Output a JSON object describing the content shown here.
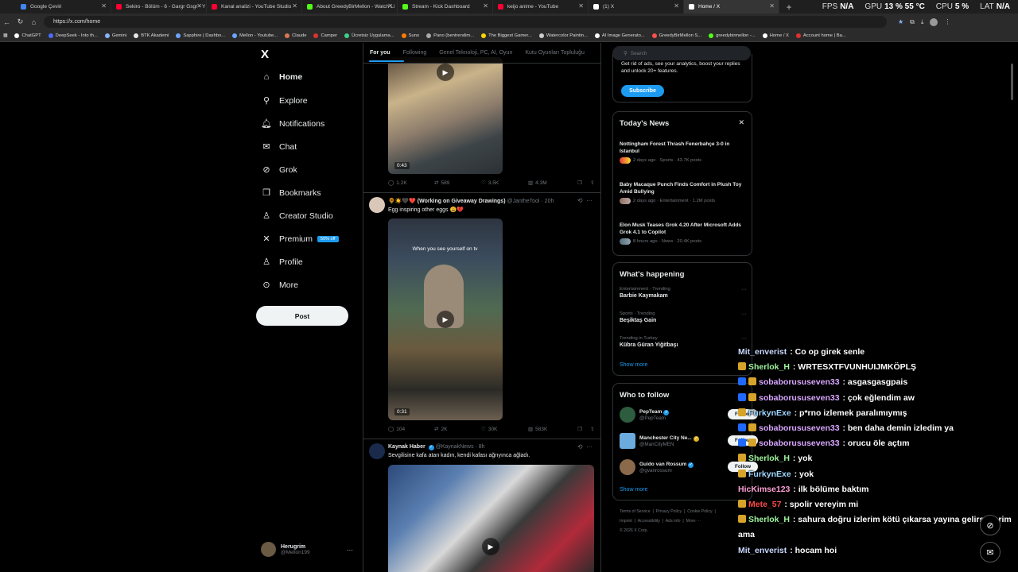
{
  "browser": {
    "tabs": [
      {
        "label": "Google Çeviri",
        "color": "#4285f4"
      },
      {
        "label": "Sekiro - Bölüm - 6 - Gargr Gsgr - Y",
        "color": "#ff0033"
      },
      {
        "label": "Kanal analizi - YouTube Studio",
        "color": "#ff0033"
      },
      {
        "label": "About GreedyBirMellon - Watch Li",
        "color": "#53fc18"
      },
      {
        "label": "Stream - Kick Dashboard",
        "color": "#53fc18"
      },
      {
        "label": "keijo anime - YouTube",
        "color": "#ff0033"
      },
      {
        "label": "(1) X",
        "color": "#ffffff"
      },
      {
        "label": "Home / X",
        "color": "#ffffff"
      }
    ],
    "url": "https://x.com/home",
    "hud": {
      "fps_label": "FPS",
      "fps_value": "N/A",
      "gpu_label": "GPU",
      "gpu_value": "13 % 55 °C",
      "cpu_label": "CPU",
      "cpu_value": "5 %",
      "lat_label": "LAT",
      "lat_value": "N/A"
    },
    "bookmarks": [
      {
        "label": "ChatGPT",
        "color": "#ffffff"
      },
      {
        "label": "DeepSeek - Into th...",
        "color": "#4d6bfe"
      },
      {
        "label": "Gemini",
        "color": "#8ab4f8"
      },
      {
        "label": "BTK Akademi",
        "color": "#e8e8e8"
      },
      {
        "label": "Sapphire | Dashbo...",
        "color": "#6aa6ff"
      },
      {
        "label": "Mellon - Youtube...",
        "color": "#6aa6ff"
      },
      {
        "label": "Claude",
        "color": "#d97757"
      },
      {
        "label": "Camper",
        "color": "#e03030"
      },
      {
        "label": "Ücretsiz Uygulama...",
        "color": "#3ecf8e"
      },
      {
        "label": "Suno",
        "color": "#ff7a00"
      },
      {
        "label": "Pano (bentrendim...",
        "color": "#aaaaaa"
      },
      {
        "label": "The Biggest Gamer...",
        "color": "#ffd700"
      },
      {
        "label": "Watercolor Paintin...",
        "color": "#cccccc"
      },
      {
        "label": "AI Image Generato...",
        "color": "#ffffff"
      },
      {
        "label": "GreedyBirMellon S...",
        "color": "#ff4f4f"
      },
      {
        "label": "greedybirmellon -...",
        "color": "#53fc18"
      },
      {
        "label": "Home / X",
        "color": "#ffffff"
      },
      {
        "label": "Account home | Ba...",
        "color": "#e03030"
      }
    ]
  },
  "nav": {
    "logo": "X",
    "items": [
      {
        "label": "Home",
        "icon": "home-icon",
        "glyph": "⌂"
      },
      {
        "label": "Explore",
        "icon": "search-icon",
        "glyph": "⚲"
      },
      {
        "label": "Notifications",
        "icon": "bell-icon",
        "glyph": "♫"
      },
      {
        "label": "Chat",
        "icon": "mail-icon",
        "glyph": "✉"
      },
      {
        "label": "Grok",
        "icon": "grok-icon",
        "glyph": "⊘"
      },
      {
        "label": "Bookmarks",
        "icon": "bookmark-icon",
        "glyph": "❒"
      },
      {
        "label": "Creator Studio",
        "icon": "creator-icon",
        "glyph": "♙"
      },
      {
        "label": "Premium",
        "icon": "x-premium-icon",
        "glyph": "✕"
      },
      {
        "label": "Profile",
        "icon": "person-icon",
        "glyph": "♙"
      },
      {
        "label": "More",
        "icon": "more-circle-icon",
        "glyph": "⊙"
      }
    ],
    "premium_badge": "50% off",
    "post_label": "Post",
    "account": {
      "name": "Herugrim",
      "handle": "@Mellon199",
      "more": "···"
    }
  },
  "feed": {
    "tabs": [
      "For you",
      "Following",
      "Genel Teknoloji, PC, AI, Oyun",
      "Kutu Oyunları Topluluğu"
    ],
    "tweet1": {
      "duration": "0:43",
      "stats": {
        "replies": "1.2K",
        "reposts": "589",
        "likes": "3.5K",
        "views": "4.3M"
      }
    },
    "tweet2": {
      "name": "🌻☀️🖤❤️ (Working on Giveaway Drawings)",
      "handle": "@JantheTool · 20h",
      "text": "Egg inspiring other eggs 😩💔",
      "overlay": "When you see yourself on tv",
      "duration": "0:31",
      "stats": {
        "replies": "104",
        "reposts": "2K",
        "likes": "30K",
        "views": "583K"
      }
    },
    "tweet3": {
      "name": "Kaynak Haber",
      "handle": "@KaynakNews · 8h",
      "text": "Sevgilisine kafa atan kadın, kendi kafası ağrıyınca ağladı."
    }
  },
  "right": {
    "search_placeholder": "Search",
    "premium_text": "Get rid of ads, see your analytics, boost your replies and unlock 20+ features.",
    "subscribe": "Subscribe",
    "news_title": "Today's News",
    "news": [
      {
        "title": "Nottingham Forest Thrash Fenerbahçe 3-0 in Istanbul",
        "meta": "2 days ago · Sports · 43.7K posts"
      },
      {
        "title": "Baby Macaque Punch Finds Comfort in Plush Toy Amid Bullying",
        "meta": "2 days ago · Entertainment · 1.2M posts"
      },
      {
        "title": "Elon Musk Teases Grok 4.20 After Microsoft Adds Grok 4.1 to Copilot",
        "meta": "8 hours ago · News · 20.4K posts"
      }
    ],
    "happening_title": "What's happening",
    "trends": [
      {
        "context": "Entertainment · Trending",
        "title": "Barbie Kaymakam"
      },
      {
        "context": "Sports · Trending",
        "title": "Beşiktaş Gain"
      },
      {
        "context": "Trending in Turkey",
        "title": "Kübra Güran Yiğitbaşı"
      }
    ],
    "show_more": "Show more",
    "wtf_title": "Who to follow",
    "follow": [
      {
        "name": "PepTeam",
        "handle": "@PepTeam",
        "color": "#2e5c3e"
      },
      {
        "name": "Manchester City Ne...",
        "handle": "@ManCityMEN",
        "color": "#6cabdd"
      },
      {
        "name": "Guido van Rossum",
        "handle": "@gvanrossum",
        "color": "#8a6a4a"
      }
    ],
    "follow_label": "Follow",
    "footer": [
      "Terms of Service",
      "Privacy Policy",
      "Cookie Policy",
      "Imprint",
      "Accessibility",
      "Ads info",
      "More ···",
      "© 2026 X Corp."
    ]
  },
  "chat": [
    {
      "user": "Mit_enverist",
      "color": "#c8d6ff",
      "text": "Co op girek senle",
      "badges": []
    },
    {
      "user": "Sherlok_H",
      "color": "#9ff59f",
      "text": "WRTESXTFVUNHUIJMKÖPLŞ",
      "badges": [
        "sub"
      ]
    },
    {
      "user": "sobaborususeven33",
      "color": "#d9a6ff",
      "text": "asgasgasgpais",
      "badges": [
        "prime",
        "sub"
      ]
    },
    {
      "user": "sobaborususeven33",
      "color": "#d9a6ff",
      "text": "çok eğlendim aw",
      "badges": [
        "prime",
        "sub"
      ]
    },
    {
      "user": "FurkynExe",
      "color": "#9fd8ff",
      "text": "p*rno izlemek paralımıymış",
      "badges": [
        "sub"
      ]
    },
    {
      "user": "sobaborususeven33",
      "color": "#d9a6ff",
      "text": "ben daha demin izledim ya",
      "badges": [
        "prime",
        "sub"
      ]
    },
    {
      "user": "sobaborususeven33",
      "color": "#d9a6ff",
      "text": "orucu öle açtım",
      "badges": [
        "prime",
        "sub"
      ]
    },
    {
      "user": "Sherlok_H",
      "color": "#9ff59f",
      "text": "yok",
      "badges": [
        "sub"
      ]
    },
    {
      "user": "FurkynExe",
      "color": "#9fd8ff",
      "text": "yok",
      "badges": [
        "sub"
      ]
    },
    {
      "user": "HicKimse123",
      "color": "#ff9fd5",
      "text": "ilk bölüme baktım",
      "badges": []
    },
    {
      "user": "Mete_57",
      "color": "#ff4a4a",
      "text": "spolir vereyim mi",
      "badges": [
        "sub"
      ]
    },
    {
      "user": "Sherlok_H",
      "color": "#9ff59f",
      "text": "sahura doğru izlerim kötü çıkarsa yayına gelirsöyerim",
      "badges": [
        "sub"
      ]
    },
    {
      "user": "",
      "color": "#ffffff",
      "text": "ama",
      "badges": []
    },
    {
      "user": "Mit_enverist",
      "color": "#c8d6ff",
      "text": "hocam hoi",
      "badges": []
    }
  ]
}
